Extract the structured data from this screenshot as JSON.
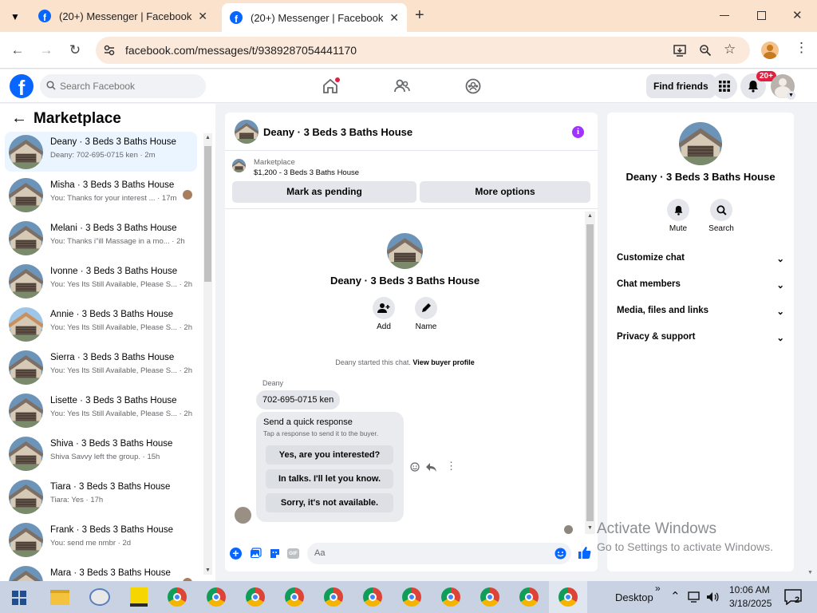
{
  "browser": {
    "tabs": [
      {
        "title": "(20+) Messenger | Facebook"
      },
      {
        "title": "(20+) Messenger | Facebook"
      }
    ],
    "url": "facebook.com/messages/t/9389287054441170",
    "new_tab_glyph": "+",
    "close_glyph": "✕"
  },
  "fb": {
    "search_placeholder": "Search Facebook",
    "find_friends": "Find friends",
    "notification_badge": "20+"
  },
  "left": {
    "title": "Marketplace",
    "conversations": [
      {
        "name": "Deany · 3 Beds 3 Baths House",
        "preview": "Deany: 702-695-0715 ken · 2m"
      },
      {
        "name": "Misha · 3 Beds 3 Baths House",
        "preview": "You: Thanks for your interest ... · 17m"
      },
      {
        "name": "Melani · 3 Beds 3 Baths House",
        "preview": "You: Thanks i\"ill Massage in a mo... · 2h"
      },
      {
        "name": "Ivonne · 3 Beds 3 Baths House",
        "preview": "You: Yes Its Still Available, Please S... · 2h"
      },
      {
        "name": "Annie · 3 Beds 3 Baths House",
        "preview": "You: Yes Its Still Available, Please S... · 2h"
      },
      {
        "name": "Sierra · 3 Beds 3 Baths House",
        "preview": "You: Yes Its Still Available, Please S... · 2h"
      },
      {
        "name": "Lisette · 3 Beds 3 Baths House",
        "preview": "You: Yes Its Still Available, Please S... · 2h"
      },
      {
        "name": "Shiva · 3 Beds 3 Baths House",
        "preview": "Shiva Savvy left the group. · 15h"
      },
      {
        "name": "Tiara · 3 Beds 3 Baths House",
        "preview": "Tiara: Yes · 17h"
      },
      {
        "name": "Frank · 3 Beds 3 Baths House",
        "preview": "You: send me nmbr · 2d"
      },
      {
        "name": "Mara · 3 Beds 3 Baths House",
        "preview": ""
      }
    ]
  },
  "chat": {
    "title": "Deany · 3 Beds 3 Baths House",
    "listing_label": "Marketplace",
    "listing_price": "$1,200 - 3 Beds 3 Baths House",
    "mark_pending": "Mark as pending",
    "more_options": "More options",
    "profile_name": "Deany · 3 Beds 3 Baths House",
    "add_label": "Add",
    "name_label": "Name",
    "started_text": "Deany started this chat.",
    "view_buyer": "View buyer profile",
    "sender": "Deany",
    "message": "702-695-0715 ken",
    "quick_title": "Send a quick response",
    "quick_sub": "Tap a response to send it to the buyer.",
    "quick_replies": [
      "Yes, are you interested?",
      "In talks. I'll let you know.",
      "Sorry, it's not available."
    ],
    "composer_placeholder": "Aa",
    "gif_label": "GIF"
  },
  "right": {
    "name": "Deany · 3 Beds 3 Baths House",
    "mute": "Mute",
    "search": "Search",
    "sections": [
      "Customize chat",
      "Chat members",
      "Media, files and links",
      "Privacy & support"
    ]
  },
  "watermark": {
    "line1": "Activate Windows",
    "line2": "Go to Settings to activate Windows."
  },
  "taskbar": {
    "desktop": "Desktop",
    "time": "10:06 AM",
    "date": "3/18/2025",
    "notif_count": "2",
    "overflow": "»"
  },
  "colors": {
    "fb_blue": "#0866ff",
    "purple": "#a033ff",
    "badge_red": "#e41e3f"
  }
}
